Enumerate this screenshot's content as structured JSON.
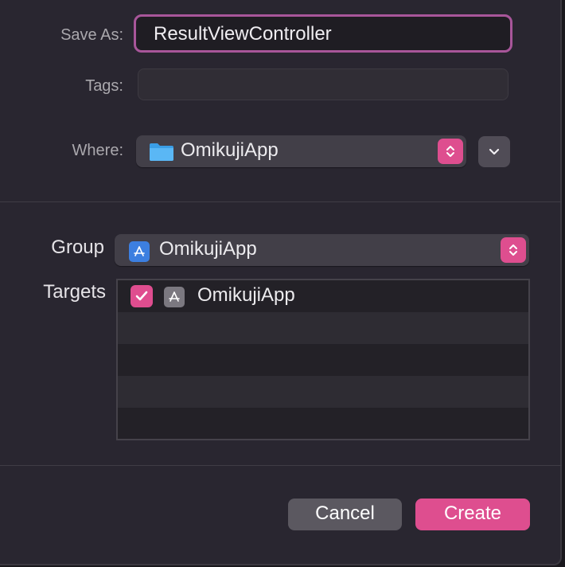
{
  "form": {
    "save_as_label": "Save As:",
    "save_as_value": "ResultViewController",
    "tags_label": "Tags:",
    "tags_value": "",
    "where_label": "Where:",
    "where_value": "OmikujiApp",
    "where_icon": "folder-icon"
  },
  "project": {
    "group_label": "Group",
    "group_value": "OmikujiApp",
    "group_icon": "app-target-icon",
    "targets_label": "Targets",
    "targets": [
      {
        "name": "OmikujiApp",
        "checked": true,
        "icon": "app-target-icon"
      }
    ]
  },
  "buttons": {
    "cancel_label": "Cancel",
    "create_label": "Create"
  },
  "colors": {
    "accent": "#de4e8f",
    "focus_ring": "#a8569a",
    "background": "#292630"
  }
}
